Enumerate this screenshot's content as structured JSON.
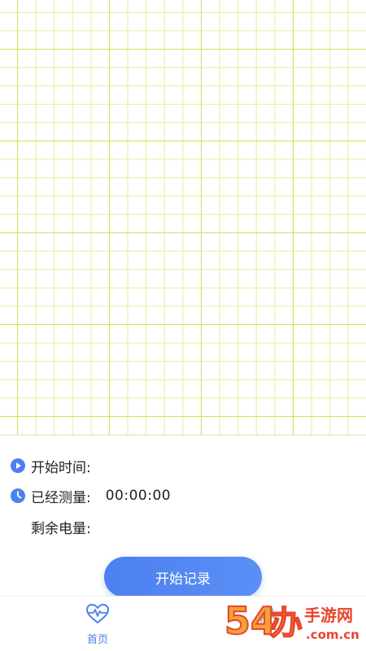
{
  "info": {
    "start_time_label": "开始时间:",
    "start_time_value": "",
    "measured_label": "已经测量:",
    "measured_value": "00:00:00",
    "battery_label": "剩余电量:",
    "battery_value": ""
  },
  "actions": {
    "start_record_label": "开始记录"
  },
  "tabbar": {
    "tabs": [
      {
        "label": "首页",
        "icon": "heart-pulse-icon",
        "active": true
      },
      {
        "label": "",
        "icon": "user-icon",
        "active": false
      }
    ]
  },
  "watermark": {
    "text": "54办手游网",
    "domain": ".com.cn"
  },
  "colors": {
    "accent": "#4c80f0",
    "grid": "#d4de4e",
    "text": "#222222",
    "watermark_red": "#e8452c",
    "watermark_orange": "#f2a23a"
  }
}
